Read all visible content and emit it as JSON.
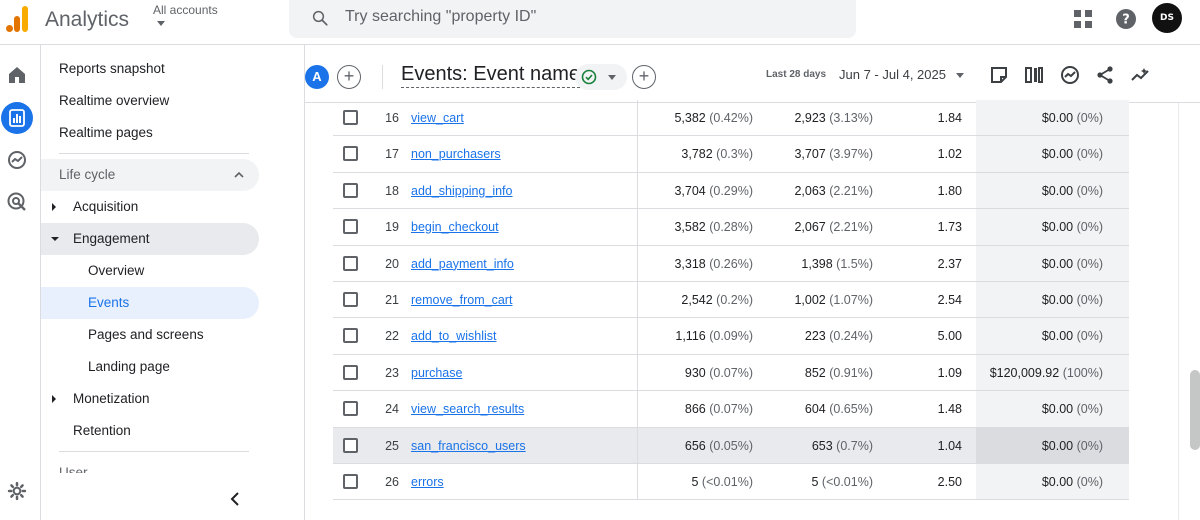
{
  "app": {
    "title": "Analytics",
    "accounts_label": "All accounts",
    "search_placeholder": "Try searching \"property ID\"",
    "avatar_text": "DS"
  },
  "sidenav": {
    "items": [
      {
        "label": "Reports snapshot"
      },
      {
        "label": "Realtime overview"
      },
      {
        "label": "Realtime pages"
      }
    ],
    "section_lifecycle": "Life cycle",
    "acquisition": "Acquisition",
    "engagement": "Engagement",
    "engagement_children": [
      "Overview",
      "Events",
      "Pages and screens",
      "Landing page"
    ],
    "monetization": "Monetization",
    "retention": "Retention",
    "section_user": "User"
  },
  "report": {
    "segment_letter": "A",
    "title": "Events: Event name",
    "date_label": "Last 28 days",
    "date_range": "Jun 7 - Jul 4, 2025"
  },
  "table": {
    "rows": [
      {
        "n": "16",
        "name": "view_cart",
        "c1": "5,382",
        "p1": "(0.42%)",
        "c2": "2,923",
        "p2": "(3.13%)",
        "c3": "1.84",
        "c4": "$0.00",
        "p4": "(0%)"
      },
      {
        "n": "17",
        "name": "non_purchasers",
        "c1": "3,782",
        "p1": "(0.3%)",
        "c2": "3,707",
        "p2": "(3.97%)",
        "c3": "1.02",
        "c4": "$0.00",
        "p4": "(0%)"
      },
      {
        "n": "18",
        "name": "add_shipping_info",
        "c1": "3,704",
        "p1": "(0.29%)",
        "c2": "2,063",
        "p2": "(2.21%)",
        "c3": "1.80",
        "c4": "$0.00",
        "p4": "(0%)"
      },
      {
        "n": "19",
        "name": "begin_checkout",
        "c1": "3,582",
        "p1": "(0.28%)",
        "c2": "2,067",
        "p2": "(2.21%)",
        "c3": "1.73",
        "c4": "$0.00",
        "p4": "(0%)"
      },
      {
        "n": "20",
        "name": "add_payment_info",
        "c1": "3,318",
        "p1": "(0.26%)",
        "c2": "1,398",
        "p2": "(1.5%)",
        "c3": "2.37",
        "c4": "$0.00",
        "p4": "(0%)"
      },
      {
        "n": "21",
        "name": "remove_from_cart",
        "c1": "2,542",
        "p1": "(0.2%)",
        "c2": "1,002",
        "p2": "(1.07%)",
        "c3": "2.54",
        "c4": "$0.00",
        "p4": "(0%)"
      },
      {
        "n": "22",
        "name": "add_to_wishlist",
        "c1": "1,116",
        "p1": "(0.09%)",
        "c2": "223",
        "p2": "(0.24%)",
        "c3": "5.00",
        "c4": "$0.00",
        "p4": "(0%)"
      },
      {
        "n": "23",
        "name": "purchase",
        "c1": "930",
        "p1": "(0.07%)",
        "c2": "852",
        "p2": "(0.91%)",
        "c3": "1.09",
        "c4": "$120,009.92",
        "p4": "(100%)"
      },
      {
        "n": "24",
        "name": "view_search_results",
        "c1": "866",
        "p1": "(0.07%)",
        "c2": "604",
        "p2": "(0.65%)",
        "c3": "1.48",
        "c4": "$0.00",
        "p4": "(0%)"
      },
      {
        "n": "25",
        "name": "san_francisco_users",
        "c1": "656",
        "p1": "(0.05%)",
        "c2": "653",
        "p2": "(0.7%)",
        "c3": "1.04",
        "c4": "$0.00",
        "p4": "(0%)"
      },
      {
        "n": "26",
        "name": "errors",
        "c1": "5",
        "p1": "(<0.01%)",
        "c2": "5",
        "p2": "(<0.01%)",
        "c3": "2.50",
        "c4": "$0.00",
        "p4": "(0%)"
      }
    ],
    "hover_row": "25"
  },
  "colors": {
    "accent": "#1a73e8",
    "selected_nav_bg": "#e8f0fe",
    "success": "#188038"
  }
}
